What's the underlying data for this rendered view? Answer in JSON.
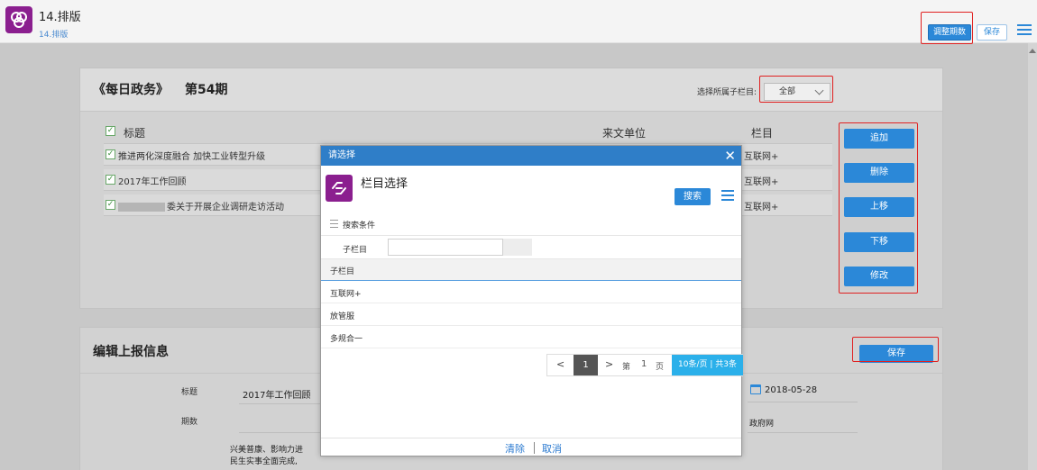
{
  "header": {
    "title": "14.排版",
    "breadcrumb": "14.排版",
    "adjust_label": "调整期数",
    "save_label": "保存"
  },
  "issue": {
    "journal": "《每日政务》",
    "number": "第54期",
    "filter_label": "选择所属子栏目:",
    "filter_value": "全部"
  },
  "table": {
    "headers": [
      "标题",
      "来文单位",
      "栏目"
    ],
    "rows": [
      {
        "title": "推进两化深度融合  加快工业转型升级",
        "unit": "",
        "column": "互联网+"
      },
      {
        "title": "2017年工作回顾",
        "unit": "",
        "column": "互联网+"
      },
      {
        "title": "委关于开展企业调研走访活动",
        "unit": "",
        "column": "互联网+"
      }
    ]
  },
  "side_buttons": [
    "追加",
    "删除",
    "上移",
    "下移",
    "修改"
  ],
  "edit": {
    "title": "编辑上报信息",
    "save_label": "保存",
    "field_title_label": "标题",
    "field_title_value": "2017年工作回顾",
    "field_issue_label": "期数",
    "date": "2018-05-28",
    "column_value": "政府网",
    "summary_line1": "兴美普康、影响力进",
    "summary_line2": "民生实事全面完成,"
  },
  "modal": {
    "bar_title": "请选择",
    "close": "✕",
    "heading": "栏目选择",
    "search_label": "搜索",
    "conditions_label": "搜索条件",
    "field_label": "子栏目",
    "field_value": "",
    "list_header": "子栏目",
    "items": [
      "互联网+",
      "放管服",
      "多规合一"
    ],
    "pager": {
      "prev": "<",
      "current": "1",
      "next": ">",
      "page_prefix": "第",
      "page_number": "1",
      "page_suffix": "页",
      "info": "10条/页 | 共3条"
    },
    "clear_label": "清除",
    "cancel_label": "取消"
  },
  "colors": {
    "accent": "#2b88d8",
    "logo": "#8b1f8f",
    "highlight": "#e02020"
  }
}
